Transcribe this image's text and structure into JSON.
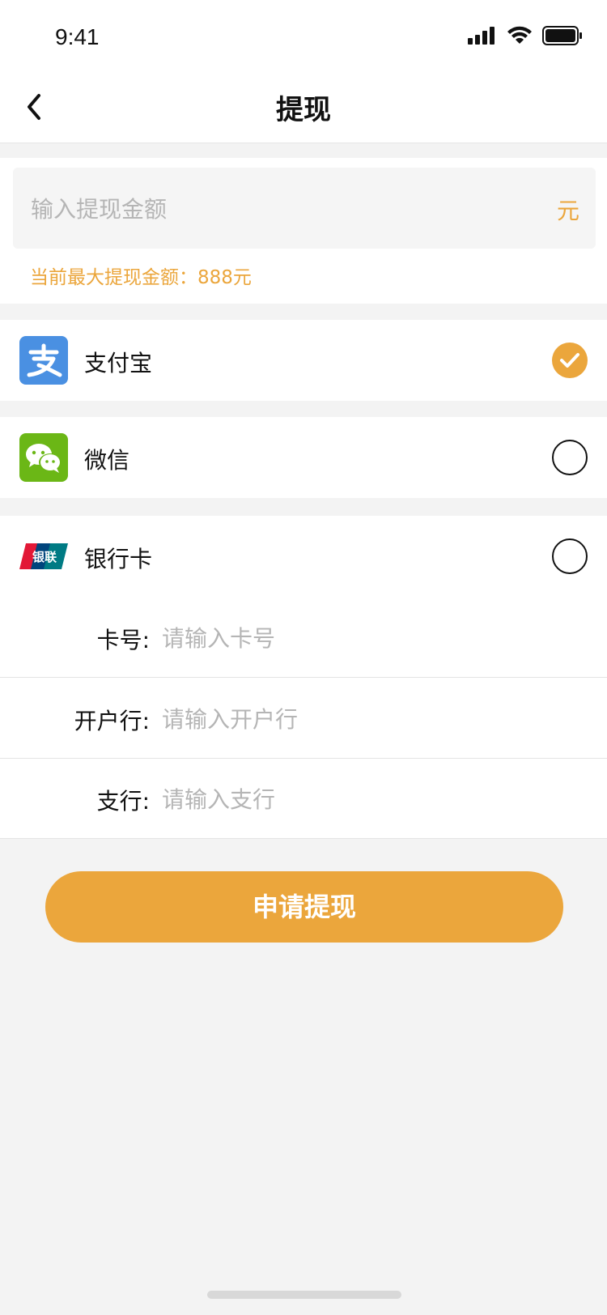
{
  "status_bar": {
    "time": "9:41",
    "icons": [
      "signal-icon",
      "wifi-icon",
      "battery-icon"
    ]
  },
  "nav": {
    "title": "提现",
    "back_icon": "chevron-left-icon"
  },
  "amount": {
    "placeholder": "输入提现金额",
    "unit": "元",
    "max_text": "当前最大提现金额：888元"
  },
  "payment_methods": [
    {
      "label": "支付宝",
      "icon": "alipay-icon",
      "selected": true
    },
    {
      "label": "微信",
      "icon": "wechat-icon",
      "selected": false
    },
    {
      "label": "银行卡",
      "icon": "unionpay-icon",
      "selected": false
    }
  ],
  "unionpay_logo_text": "银联",
  "bank_fields": [
    {
      "label": "卡号:",
      "placeholder": "请输入卡号"
    },
    {
      "label": "开户行:",
      "placeholder": "请输入开户行"
    },
    {
      "label": "支行:",
      "placeholder": "请输入支行"
    }
  ],
  "submit_label": "申请提现",
  "colors": {
    "accent": "#EBA63C",
    "alipay": "#4A90E2",
    "wechat": "#6BB716",
    "background": "#F3F3F3"
  }
}
